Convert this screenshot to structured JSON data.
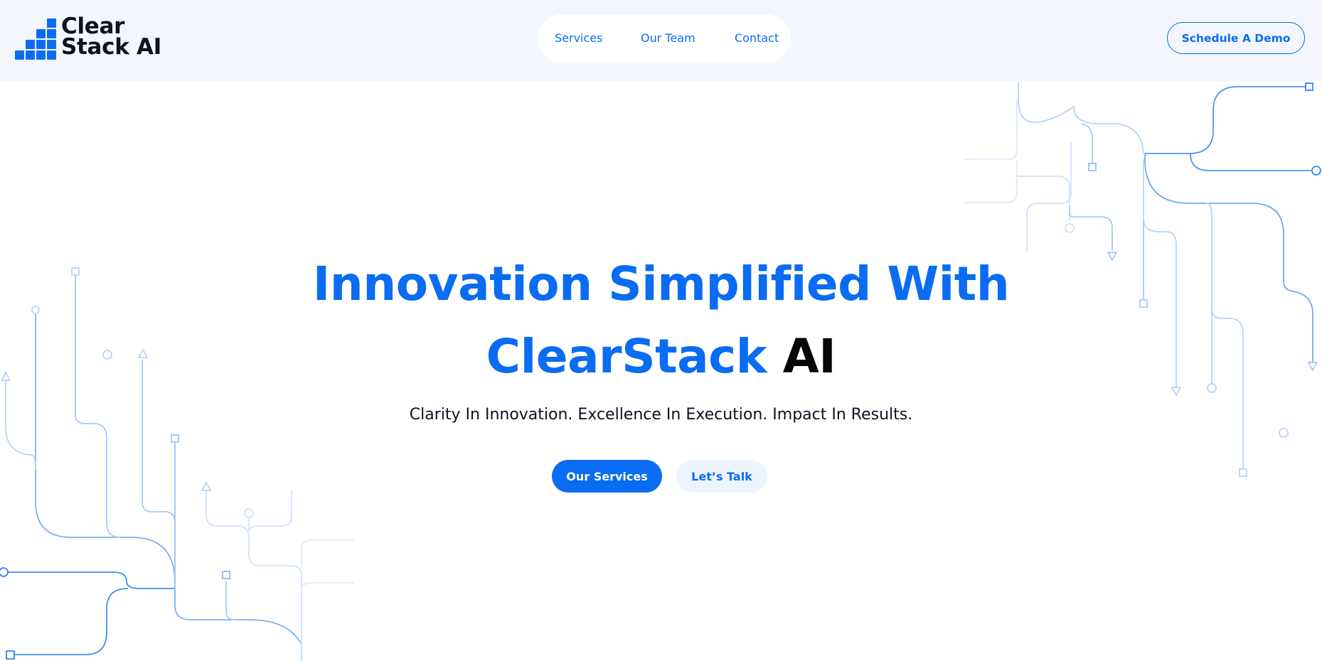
{
  "header": {
    "logo": {
      "line1": "Clear",
      "line2": "Stack AI"
    },
    "nav": [
      {
        "label": "Services"
      },
      {
        "label": "Our Team"
      },
      {
        "label": "Contact"
      }
    ],
    "cta_label": "Schedule A Demo"
  },
  "hero": {
    "title_line1": "Innovation Simplified With",
    "title_brand": "ClearStack",
    "title_suffix": "AI",
    "subtitle": "Clarity In Innovation. Excellence In Execution. Impact In Results.",
    "primary_button": "Our Services",
    "secondary_button": "Let’s Talk"
  },
  "colors": {
    "accent": "#0a6cf2",
    "header_bg": "#f3f7fd",
    "heading_dark": "#050607",
    "circuit_line": "#2f86f3"
  },
  "icons": [
    "logo-blocks-icon",
    "circuit-decoration"
  ]
}
